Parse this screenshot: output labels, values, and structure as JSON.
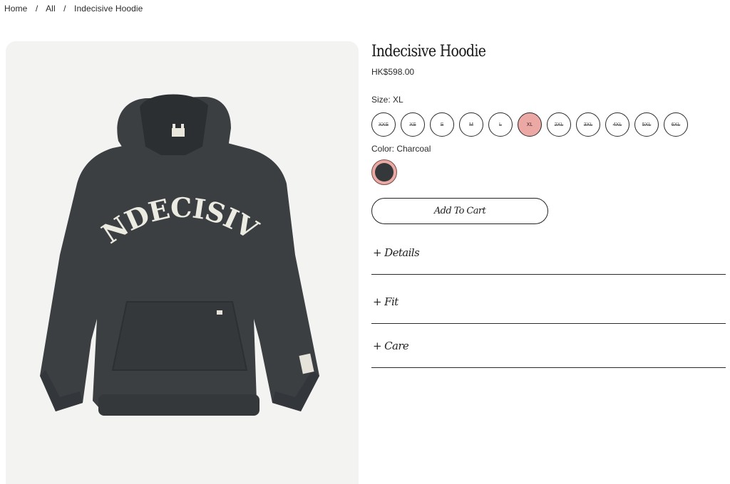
{
  "breadcrumb": {
    "home": "Home",
    "all": "All",
    "current": "Indecisive Hoodie",
    "separator": "/"
  },
  "product": {
    "title": "Indecisive Hoodie",
    "price": "HK$598.00",
    "image_text": "INDECISIVE",
    "image_color": "#3b3f42"
  },
  "size": {
    "label": "Size: XL",
    "options": [
      "XXS",
      "XS",
      "S",
      "M",
      "L",
      "XL",
      "2XL",
      "3XL",
      "4XL",
      "5XL",
      "6XL"
    ],
    "selected": "XL",
    "selected_color": "#eba8a4"
  },
  "color": {
    "label": "Color: Charcoal",
    "swatch_color": "#35383b"
  },
  "cart": {
    "label": "Add To Cart"
  },
  "accordion": {
    "details": "+ Details",
    "fit": "+ Fit",
    "care": "+ Care"
  }
}
